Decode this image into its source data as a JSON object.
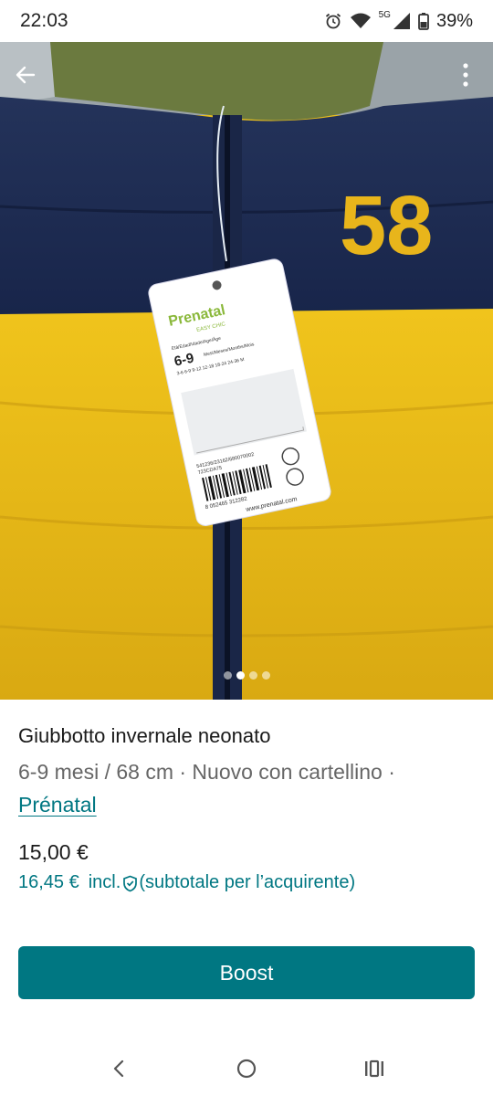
{
  "status_bar": {
    "time": "22:03",
    "network": "5G",
    "battery": "39%",
    "icons": [
      "alarm-icon",
      "wifi-icon",
      "signal-icon",
      "battery-icon"
    ]
  },
  "gallery": {
    "image_count": 4,
    "active_index": 1,
    "icons": [
      "back-arrow-icon",
      "more-vertical-icon"
    ],
    "photo": {
      "jacket_number": "58",
      "tag": {
        "brand": "Prenatal",
        "line": "EASY CHIC",
        "age_header": "Età/Edad/Idade/Age/Âge",
        "size": "6-9",
        "size_unit": "Mesi/Meses/Months/Mois",
        "size_row": "3-6  6-9  9-12 12-18 18-24 24-36 M",
        "code": "541236/23162/680070002",
        "code2": "723CDA75",
        "barcode_number": "8 052465 312282",
        "website": "www.prenatal.com"
      }
    }
  },
  "listing": {
    "title": "Giubbotto invernale neonato",
    "details": "6-9 mesi / 68 cm · Nuovo con cartellino ·",
    "brand": "Prénatal",
    "price": "15,00 €",
    "price_incl_amount": "16,45 €",
    "price_incl_label": "incl.",
    "price_incl_note": "(subtotale per l’acquirente)"
  },
  "actions": {
    "boost_label": "Boost"
  },
  "colors": {
    "accent": "#007782",
    "jacket_navy": "#1c2b4f",
    "jacket_yellow": "#e7bd1f",
    "hood_olive": "#6b7a3f"
  },
  "nav_bar": {
    "icons": [
      "nav-back-icon",
      "nav-home-icon",
      "nav-recents-icon"
    ]
  }
}
